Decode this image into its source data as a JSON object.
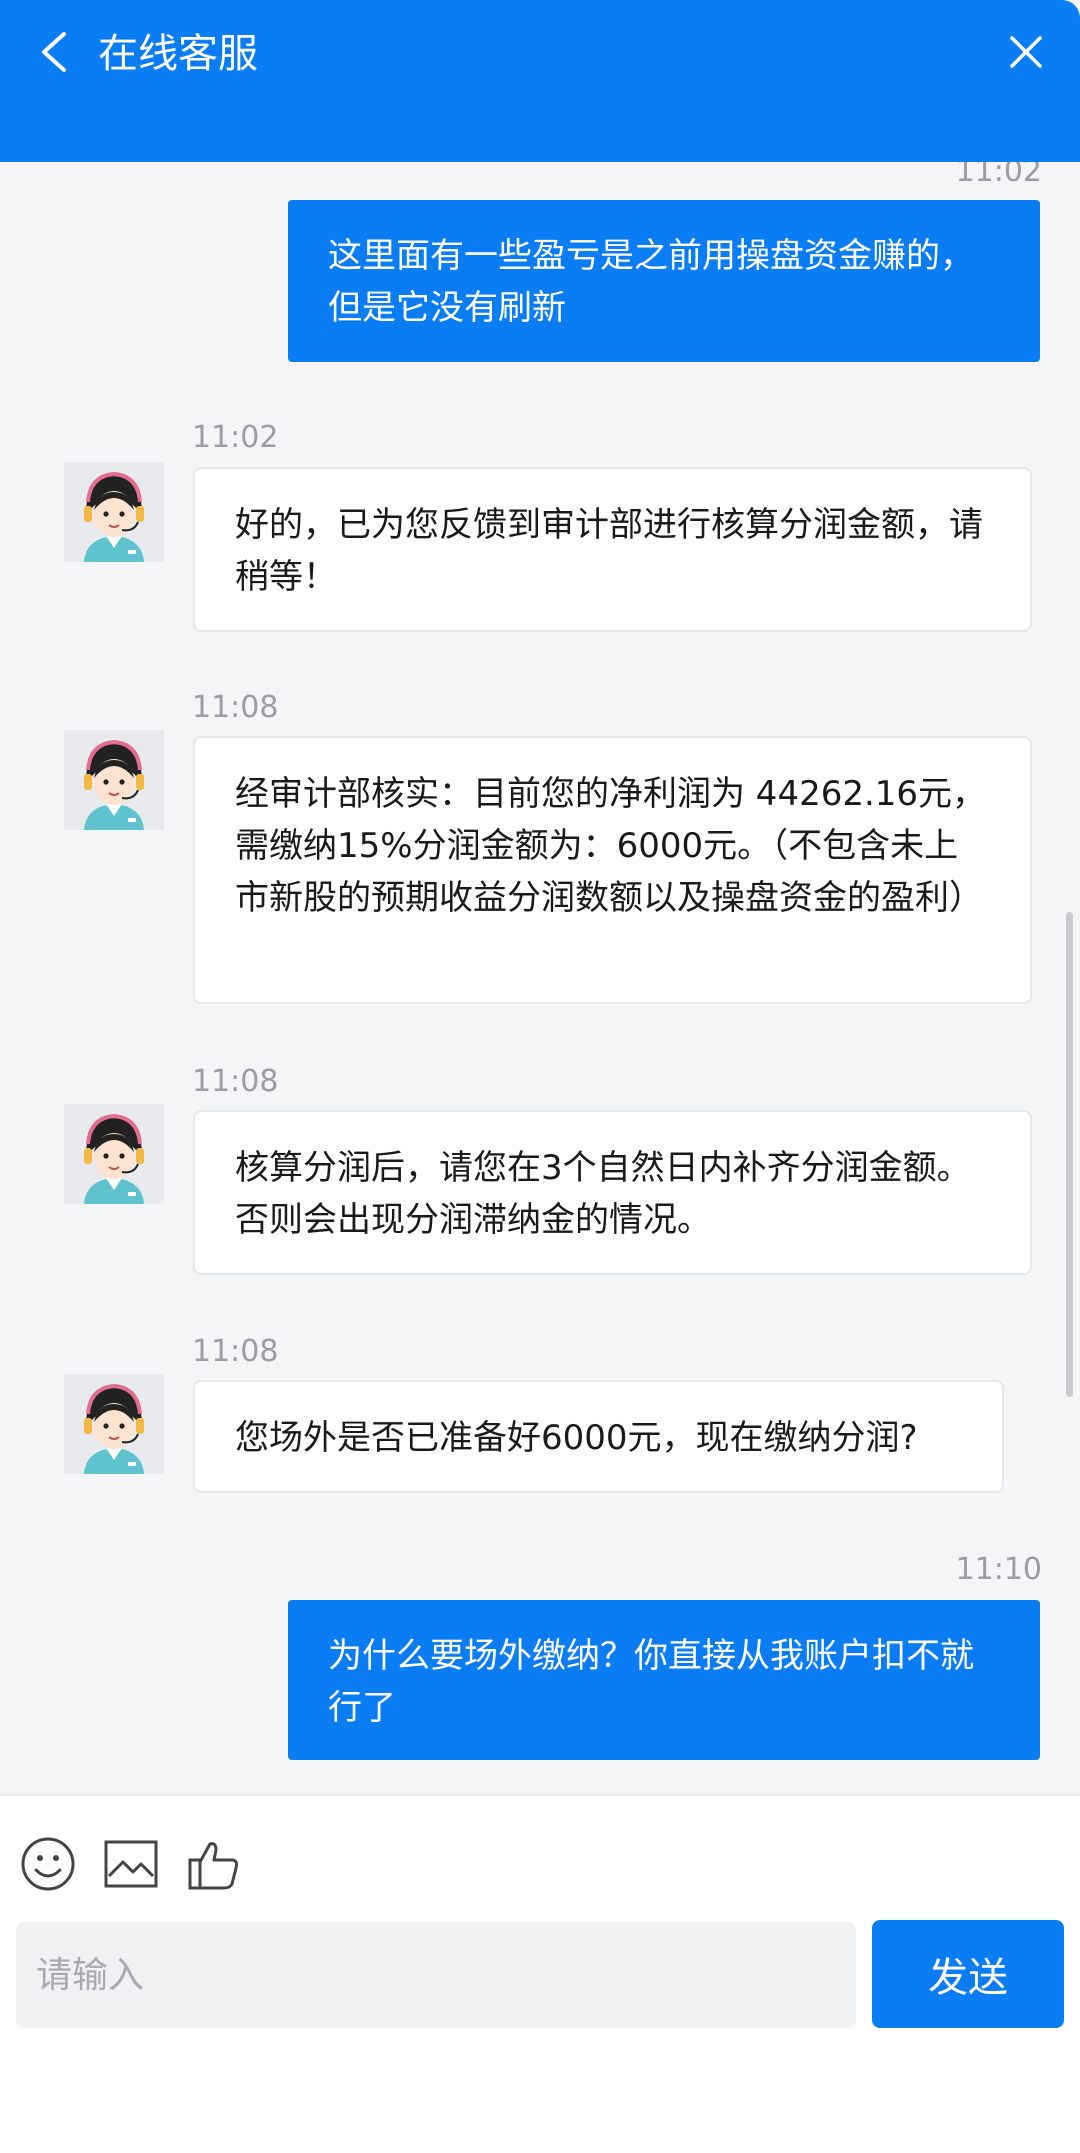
{
  "header": {
    "title": "在线客服",
    "back_icon": "chevron-left-icon",
    "close_icon": "close-icon",
    "color": "#0a7cf4"
  },
  "messages": [
    {
      "side": "me",
      "time": "11:02",
      "text": "这里面有一些盈亏是之前用操盘资金赚的，但是它没有刷新"
    },
    {
      "side": "agent",
      "time": "11:02",
      "text": "好的，已为您反馈到审计部进行核算分润金额，请稍等！"
    },
    {
      "side": "agent",
      "time": "11:08",
      "text": "经审计部核实：目前您的净利润为 44262.16元，需缴纳15%分润金额为：6000元。（不包含未上市新股的预期收益分润数额以及操盘资金的盈利）"
    },
    {
      "side": "agent",
      "time": "11:08",
      "text": "核算分润后，请您在3个自然日内补齐分润金额。否则会出现分润滞纳金的情况。"
    },
    {
      "side": "agent",
      "time": "11:08",
      "text": "您场外是否已准备好6000元，现在缴纳分润?"
    },
    {
      "side": "me",
      "time": "11:10",
      "text": "为什么要场外缴纳？你直接从我账户扣不就行了"
    }
  ],
  "toolbar": {
    "emoji_icon": "emoji-icon",
    "image_icon": "image-icon",
    "like_icon": "thumbs-up-icon"
  },
  "composer": {
    "placeholder": "请输入",
    "send_label": "发送"
  }
}
